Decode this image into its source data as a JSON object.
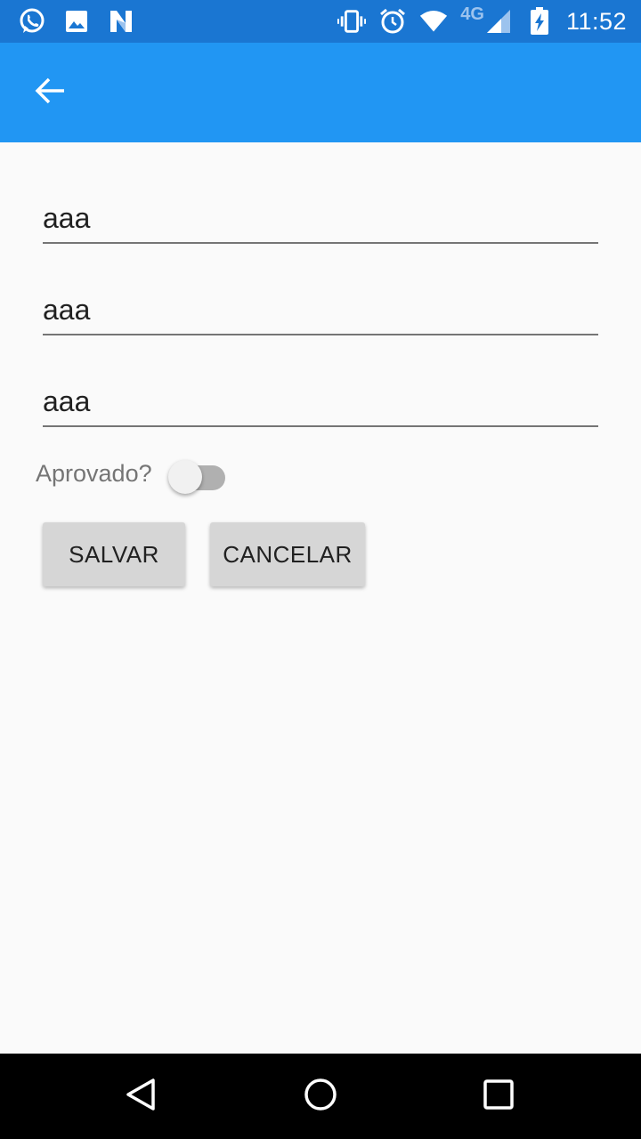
{
  "status_bar": {
    "network_type": "4G",
    "time": "11:52",
    "icons": [
      "whatsapp-icon",
      "image-icon",
      "n-icon",
      "vibrate-icon",
      "alarm-icon",
      "wifi-icon",
      "signal-icon",
      "battery-charging-icon"
    ],
    "background_color": "#1a76d2"
  },
  "app_bar": {
    "back_icon": "arrow-left-icon",
    "background_color": "#2196f3"
  },
  "form": {
    "field_1_value": "aaa",
    "field_2_value": "aaa",
    "field_3_value": "aaa",
    "approved_label": "Aprovado?",
    "approved_on": false,
    "save_label": "SALVAR",
    "cancel_label": "CANCELAR"
  },
  "nav_bar": {
    "icons": [
      "nav-back-icon",
      "nav-home-icon",
      "nav-recents-icon"
    ]
  }
}
